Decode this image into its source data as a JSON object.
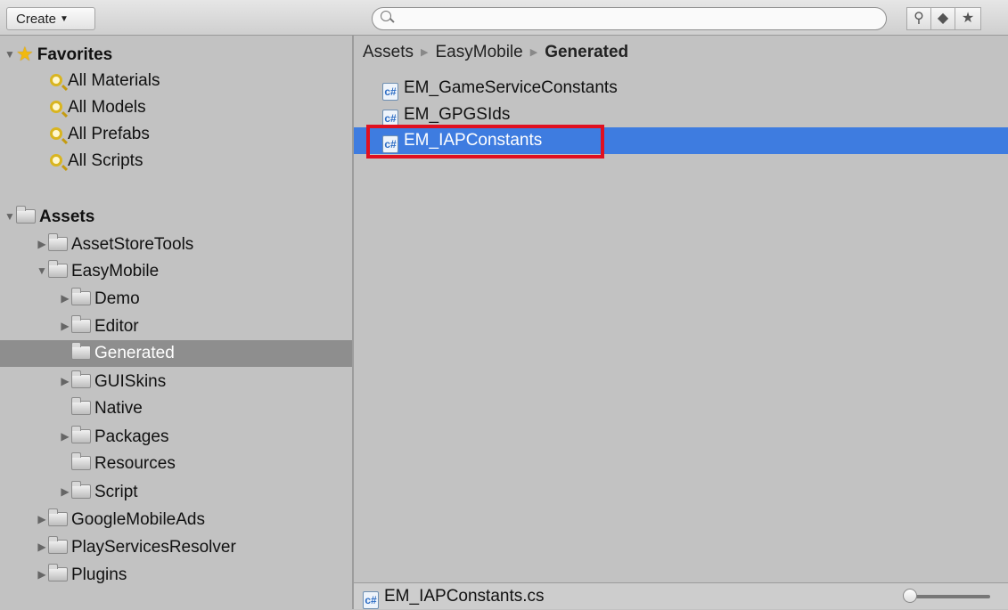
{
  "toolbar": {
    "create_label": "Create",
    "search_placeholder": "",
    "icons": [
      "filter-by-type-icon",
      "filter-by-label-icon",
      "favorite-star-icon"
    ]
  },
  "tree": {
    "favorites": {
      "label": "Favorites",
      "items": [
        "All Materials",
        "All Models",
        "All Prefabs",
        "All Scripts"
      ]
    },
    "assets": {
      "label": "Assets",
      "items": [
        {
          "label": "AssetStoreTools"
        },
        {
          "label": "EasyMobile"
        },
        {
          "label": "Demo"
        },
        {
          "label": "Editor"
        },
        {
          "label": "Generated"
        },
        {
          "label": "GUISkins"
        },
        {
          "label": "Native"
        },
        {
          "label": "Packages"
        },
        {
          "label": "Resources"
        },
        {
          "label": "Script"
        },
        {
          "label": "GoogleMobileAds"
        },
        {
          "label": "PlayServicesResolver"
        },
        {
          "label": "Plugins"
        }
      ]
    },
    "selected": "Generated"
  },
  "breadcrumb": [
    "Assets",
    "EasyMobile",
    "Generated"
  ],
  "files": [
    "EM_GameServiceConstants",
    "EM_GPGSIds",
    "EM_IAPConstants"
  ],
  "selected_file": "EM_IAPConstants",
  "status": {
    "selected_path": "EM_IAPConstants.cs",
    "zoom_fraction": 0
  },
  "colors": {
    "selection_blue": "#3e7ce0",
    "tree_selection": "#8e8e8e",
    "highlight_red": "#e01020",
    "panel_bg": "#c2c2c2"
  }
}
